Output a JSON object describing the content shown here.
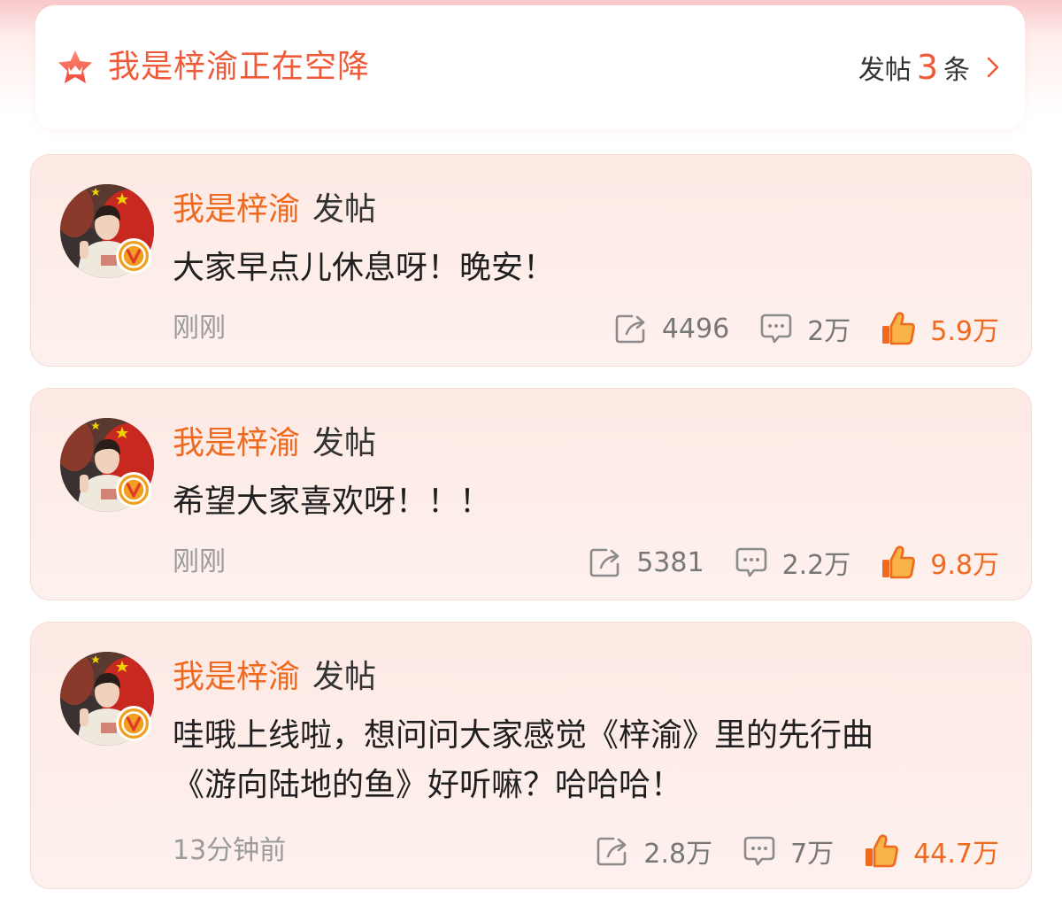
{
  "header": {
    "title": "我是梓渝正在空降",
    "count_prefix": "发帖",
    "count": "3",
    "count_suffix": "条",
    "icon": "star-crown-icon",
    "accent": "#ef5b3a"
  },
  "posts": [
    {
      "author": "我是梓渝",
      "action": "发帖",
      "text": "大家早点儿休息呀！晚安！",
      "time": "刚刚",
      "reposts": "4496",
      "comments": "2万",
      "likes": "5.9万"
    },
    {
      "author": "我是梓渝",
      "action": "发帖",
      "text": "希望大家喜欢呀！！！",
      "time": "刚刚",
      "reposts": "5381",
      "comments": "2.2万",
      "likes": "9.8万"
    },
    {
      "author": "我是梓渝",
      "action": "发帖",
      "text_line1": "哇哦上线啦，想问问大家感觉《梓渝》里的先行曲",
      "text_line2": "《游向陆地的鱼》好听嘛？哈哈哈！",
      "time": "13分钟前",
      "reposts": "2.8万",
      "comments": "7万",
      "likes": "44.7万"
    }
  ],
  "colors": {
    "author": "#ef6a1e",
    "like": "#ef6a1e",
    "badge": "#f0a020",
    "card_bg": "#fdece8"
  }
}
